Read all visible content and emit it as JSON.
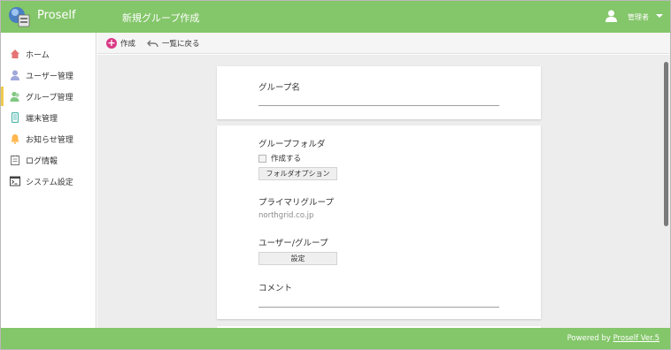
{
  "header": {
    "app_name": "Proself",
    "page_title": "新規グループ作成",
    "user_label": "管理者",
    "bg_color": "#84c66a"
  },
  "sidebar": {
    "items": [
      {
        "label": "ホーム",
        "icon": "home-icon",
        "color": "#e57373"
      },
      {
        "label": "ユーザー管理",
        "icon": "user-icon",
        "color": "#9fa8da"
      },
      {
        "label": "グループ管理",
        "icon": "group-icon",
        "color": "#81c784",
        "active": true
      },
      {
        "label": "端末管理",
        "icon": "device-icon",
        "color": "#4db6ac"
      },
      {
        "label": "お知らせ管理",
        "icon": "bell-icon",
        "color": "#ffb74d"
      },
      {
        "label": "ログ情報",
        "icon": "notepad-icon",
        "color": "#757575"
      },
      {
        "label": "システム設定",
        "icon": "terminal-icon",
        "color": "#424242"
      }
    ],
    "active_color": "#efc94c"
  },
  "toolbar": {
    "create_label": "作成",
    "back_label": "一覧に戻る"
  },
  "form": {
    "group_name_label": "グループ名",
    "group_name_value": "",
    "group_folder_label": "グループフォルダ",
    "create_checkbox_label": "作成する",
    "folder_option_button": "フォルダオプション",
    "primary_group_label": "プライマリグループ",
    "primary_group_value": "northgrid.co.jp",
    "user_group_label": "ユーザー/グループ",
    "settings_button": "設定",
    "comment_label": "コメント",
    "comment_value": ""
  },
  "footer": {
    "powered_by": "Powered by",
    "link_text": "Proself Ver.5"
  }
}
